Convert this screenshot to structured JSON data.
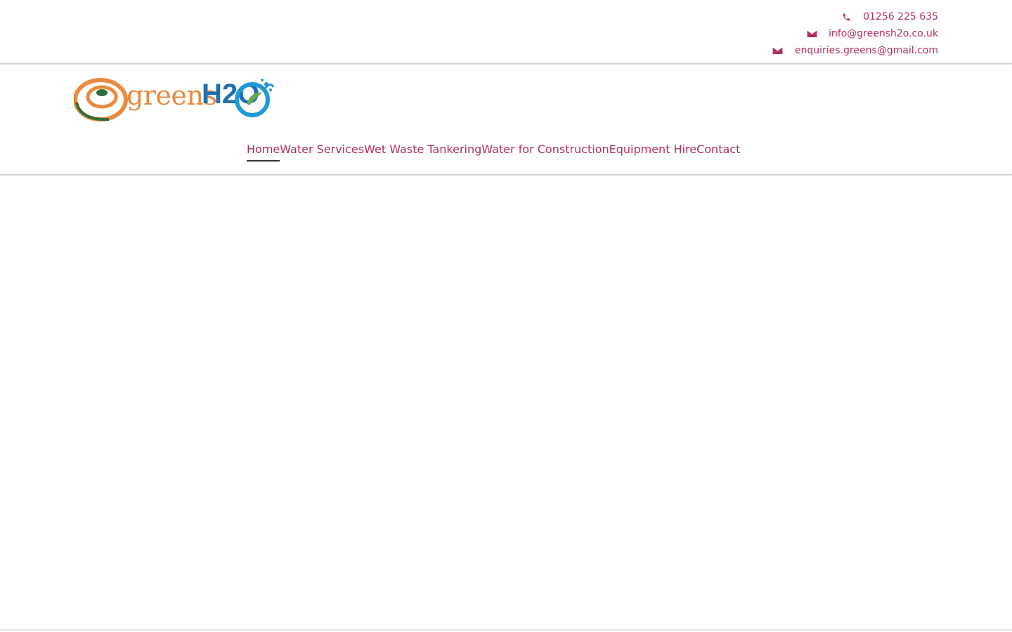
{
  "contact": {
    "phone": "01256 225 635",
    "email_1": "info@greensh2o.co.uk",
    "email_2": "enquiries.greens@gmail.com"
  },
  "brand": {
    "name_part_1": "greens",
    "name_part_2": "H2O"
  },
  "nav": {
    "items": [
      {
        "label": "Home"
      },
      {
        "label": "Water Services"
      },
      {
        "label": "Wet Waste Tankering"
      },
      {
        "label": "Water for Construction"
      },
      {
        "label": "Equipment Hire"
      },
      {
        "label": "Contact"
      }
    ],
    "active_index": 0
  },
  "colors": {
    "accent": "#b0305e",
    "logo_orange": "#e98a3f",
    "logo_green": "#2e6b3a",
    "logo_blue": "#1e6fb3"
  },
  "icons": {
    "phone": "phone-icon",
    "email": "envelope-icon"
  }
}
